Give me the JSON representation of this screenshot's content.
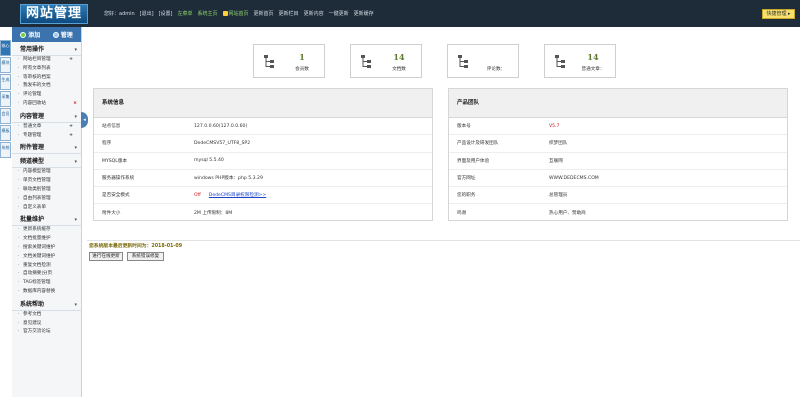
{
  "header": {
    "logo": "网站管理",
    "nav": [
      {
        "label": "您好：admin",
        "style": "plain"
      },
      {
        "label": "[退出]",
        "style": "plain"
      },
      {
        "label": "[设置]",
        "style": "plain"
      },
      {
        "label": "左菜单",
        "style": "green"
      },
      {
        "label": "系统主页",
        "style": "green"
      },
      {
        "label": "网站首页",
        "style": "green",
        "icon": "home-icon"
      },
      {
        "label": "更新首页",
        "style": "plain"
      },
      {
        "label": "更新栏目",
        "style": "plain"
      },
      {
        "label": "更新内容",
        "style": "plain"
      },
      {
        "label": "一键更新",
        "style": "plain"
      },
      {
        "label": "更新缓存",
        "style": "plain"
      }
    ],
    "quick_button": "快捷管理 ▸"
  },
  "vtabs": [
    "核心",
    "模块",
    "生成",
    "采集",
    "会员",
    "模板",
    "系统"
  ],
  "sidebar": {
    "add_label": "添加",
    "manage_label": "管理",
    "groups": [
      {
        "title": "常用操作",
        "items": [
          {
            "label": "网站栏目管理",
            "plus": true
          },
          {
            "label": "所有文章列表"
          },
          {
            "label": "等审核的档案"
          },
          {
            "label": "我发布的文档"
          },
          {
            "label": "评论管理"
          },
          {
            "label": "内容回收站",
            "x": true
          }
        ]
      },
      {
        "title": "内容管理",
        "items": [
          {
            "label": "普通文章",
            "plus": true
          },
          {
            "label": "专题管理",
            "plus": true
          }
        ]
      },
      {
        "title": "附件管理",
        "items": []
      },
      {
        "title": "频道模型",
        "items": [
          {
            "label": "内容模型管理"
          },
          {
            "label": "单页文档管理"
          },
          {
            "label": "联动类别管理"
          },
          {
            "label": "自由列表管理"
          },
          {
            "label": "自定义表单"
          }
        ]
      },
      {
        "title": "批量维护",
        "items": [
          {
            "label": "更新系统缓存"
          },
          {
            "label": "文档批量维护"
          },
          {
            "label": "搜索关键词维护"
          },
          {
            "label": "文档关键词维护"
          },
          {
            "label": "重复文档检测"
          },
          {
            "label": "自动摘要|分页"
          },
          {
            "label": "TAG标签管理"
          },
          {
            "label": "数据库内容替换"
          }
        ]
      },
      {
        "title": "系统帮助",
        "items": [
          {
            "label": "参考文档"
          },
          {
            "label": "意见建议"
          },
          {
            "label": "官方交流论坛"
          }
        ]
      }
    ]
  },
  "stats": [
    {
      "num": "1",
      "label": "会员数"
    },
    {
      "num": "14",
      "label": "文档数"
    },
    {
      "num": "",
      "label": "评论数："
    },
    {
      "num": "14",
      "label": "普通文章："
    }
  ],
  "sysinfo": {
    "title": "系统信息",
    "rows": [
      {
        "k": "站点信息",
        "v": "127.0.0.60(127.0.0.60)",
        "style": "plain"
      },
      {
        "k": "程序",
        "v": "DedeCMSV57_UTF8_SP2",
        "style": "plain"
      },
      {
        "k": "MYSQL版本",
        "v": "mysql 5.5.40",
        "style": "plain"
      },
      {
        "k": "服务器操作系统",
        "v": "windows PHP版本：php 5.3.29",
        "style": "plain"
      },
      {
        "k": "是否安全模式",
        "v": "Off",
        "v2": "DedeCMS目录权限检测>>",
        "style": "red"
      },
      {
        "k": "附件大小",
        "v": "2M 上传限制：8M",
        "style": "plain"
      }
    ]
  },
  "product": {
    "title": "产品团队",
    "rows": [
      {
        "k": "版本号",
        "v": "V5.7",
        "style": "red"
      },
      {
        "k": "产品设计及研发团队",
        "v": "织梦团队",
        "style": "plain"
      },
      {
        "k": "界面及用户体验",
        "v": "互联网",
        "style": "plain"
      },
      {
        "k": "官方网址",
        "v": "WWW.DEDECMS.COM",
        "style": "plain"
      },
      {
        "k": "您的职务",
        "v": "总管理员",
        "style": "plain"
      },
      {
        "k": "鸣谢",
        "v": "热心用户、赞助商",
        "style": "plain"
      }
    ]
  },
  "bottom": {
    "update_text": "您系统版本最后更新时间为：2018-01-09",
    "btn_online": "进行在线更新",
    "btn_fix": "系统错误修复"
  }
}
